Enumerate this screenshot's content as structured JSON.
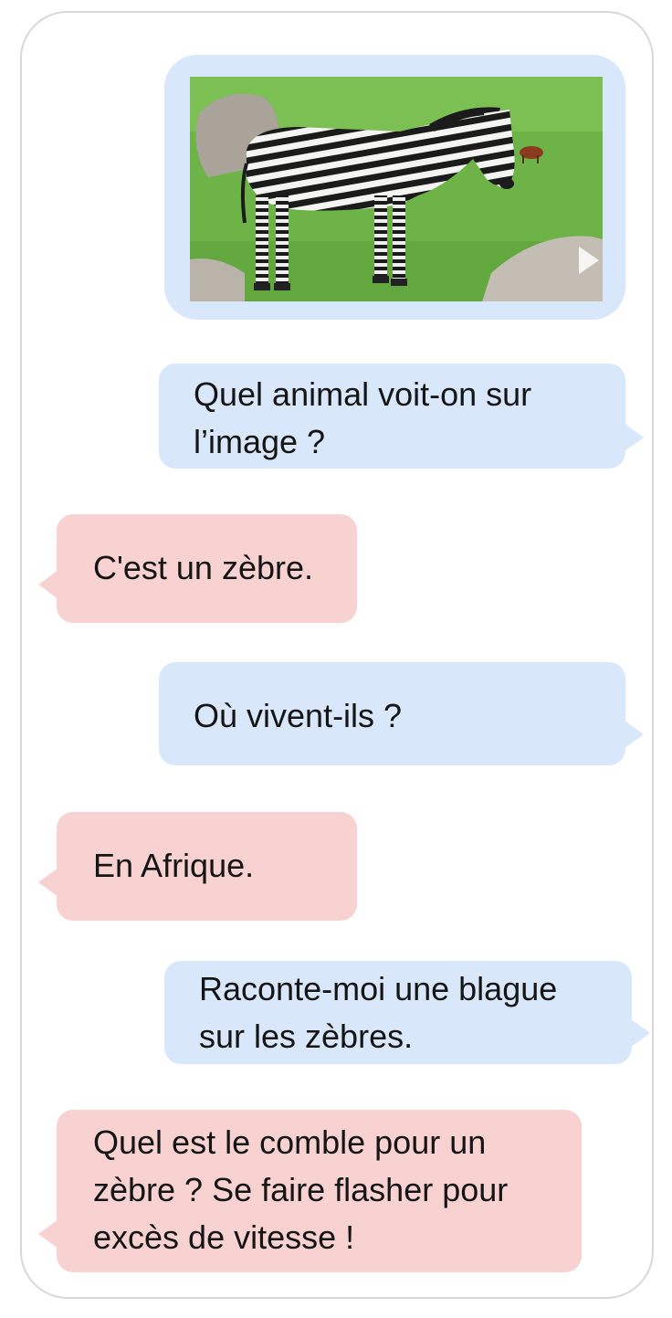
{
  "conversation": {
    "image_message": {
      "image_subject": "zebra standing on green grass",
      "icon": "play-icon"
    },
    "messages": [
      {
        "role": "user",
        "text": "Quel animal voit-on sur\nl’image ?"
      },
      {
        "role": "assistant",
        "text": "C'est un zèbre."
      },
      {
        "role": "user",
        "text": "Où vivent-ils ?"
      },
      {
        "role": "assistant",
        "text": "En Afrique."
      },
      {
        "role": "user",
        "text": "Raconte-moi une blague\nsur les zèbres."
      },
      {
        "role": "assistant",
        "text": "Quel est le comble pour un\nzèbre ? Se faire flasher pour\nexcès de vitesse !"
      }
    ]
  },
  "colors": {
    "user_bubble": "#d9e7fb",
    "assistant_bubble": "#f8d1d1",
    "frame_border": "#d8d8d8"
  }
}
